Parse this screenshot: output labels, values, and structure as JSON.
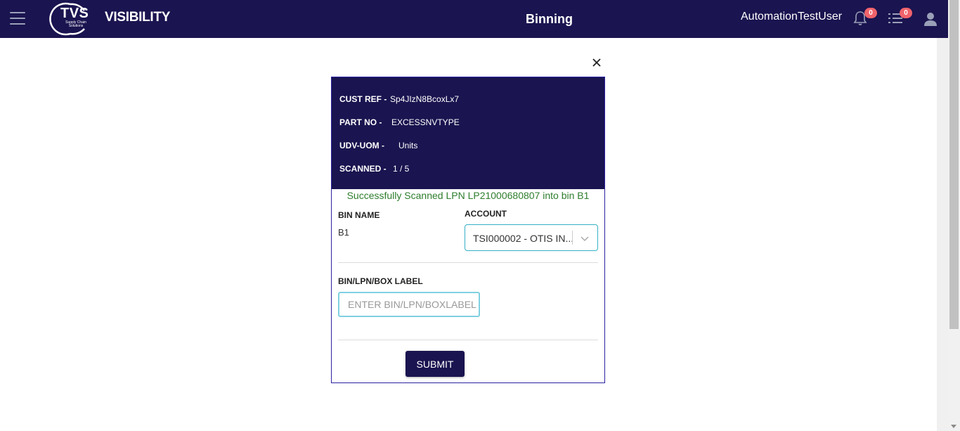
{
  "header": {
    "logo_text": "TVS",
    "logo_subtext": "Supply Chain Solutions",
    "app_name": "VISIBILITY",
    "page_title": "Binning",
    "username": "AutomationTestUser",
    "notifications_count": "0",
    "tasks_count": "0"
  },
  "info": {
    "cust_ref_label": "CUST REF -",
    "cust_ref_value": "Sp4JIzN8BcoxLx7",
    "part_no_label": "PART NO -",
    "part_no_value": "EXCESSNVTYPE",
    "udv_uom_label": "UDV-UOM -",
    "udv_uom_value": "Units",
    "scanned_label": "SCANNED -",
    "scanned_value": "1 / 5"
  },
  "form": {
    "success_message": "Successfully Scanned LPN LP21000680807 into bin B1",
    "bin_name_label": "BIN NAME",
    "bin_name_value": "B1",
    "account_label": "ACCOUNT",
    "account_value": "TSI000002 - OTIS IN...",
    "bin_label_label": "BIN/LPN/BOX LABEL",
    "bin_label_placeholder": "ENTER BIN/LPN/BOXLABEL",
    "submit_label": "SUBMIT"
  },
  "colors": {
    "navy": "#1a1450",
    "success": "#2e7d2e",
    "badge": "#f0636b",
    "accent_border": "#36b0c6"
  },
  "icons": [
    "menu-icon",
    "bell-icon",
    "task-list-icon",
    "user-icon",
    "close-icon",
    "chevron-down-icon"
  ]
}
